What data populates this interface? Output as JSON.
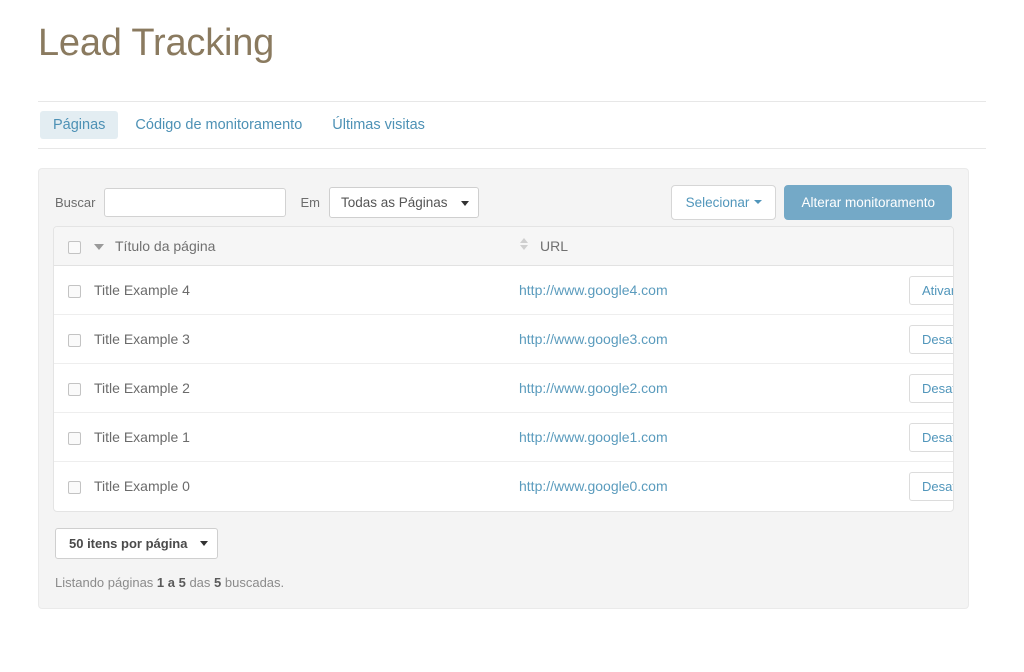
{
  "page": {
    "title": "Lead Tracking"
  },
  "tabs": [
    {
      "label": "Páginas",
      "active": true
    },
    {
      "label": "Código de monitoramento",
      "active": false
    },
    {
      "label": "Últimas visitas",
      "active": false
    }
  ],
  "toolbar": {
    "search_label": "Buscar",
    "search_value": "",
    "search_placeholder": "",
    "in_label": "Em",
    "scope_select": {
      "selected": "Todas as Páginas",
      "options": [
        "Todas as Páginas"
      ],
      "caret_icon": "caret-down-icon"
    },
    "select_button": {
      "label": "Selecionar",
      "caret_icon": "caret-down-icon"
    },
    "primary_button": {
      "label": "Alterar monitoramento"
    }
  },
  "table": {
    "select_all_checkbox": false,
    "columns": [
      {
        "key": "check",
        "label": ""
      },
      {
        "key": "title",
        "label": "Título da página",
        "sort_icon": "sort-descending-icon",
        "sorted": true
      },
      {
        "key": "url",
        "label": "URL",
        "sort_icon": "sort-unsorted-icon",
        "sorted": false
      },
      {
        "key": "action",
        "label": ""
      }
    ],
    "rows": [
      {
        "checked": false,
        "title": "Title Example 4",
        "url": "http://www.google4.com",
        "action": "Ativar"
      },
      {
        "checked": false,
        "title": "Title Example 3",
        "url": "http://www.google3.com",
        "action": "Desativar"
      },
      {
        "checked": false,
        "title": "Title Example 2",
        "url": "http://www.google2.com",
        "action": "Desativar"
      },
      {
        "checked": false,
        "title": "Title Example 1",
        "url": "http://www.google1.com",
        "action": "Desativar"
      },
      {
        "checked": false,
        "title": "Title Example 0",
        "url": "http://www.google0.com",
        "action": "Desativar"
      }
    ]
  },
  "footer": {
    "per_page_select": {
      "selected": "50 itens por página",
      "options": [
        "50 itens por página"
      ],
      "caret_icon": "caret-down-icon"
    },
    "listing": {
      "prefix": "Listando páginas ",
      "range": "1 a 5",
      "middle": " das ",
      "total": "5",
      "suffix": " buscadas."
    }
  },
  "colors": {
    "title": "#8a7a5f",
    "link": "#5a9bbd",
    "primary_button": "#74a9c7",
    "active_tab_bg": "#e3edf2",
    "panel_bg": "#f4f4f4"
  }
}
